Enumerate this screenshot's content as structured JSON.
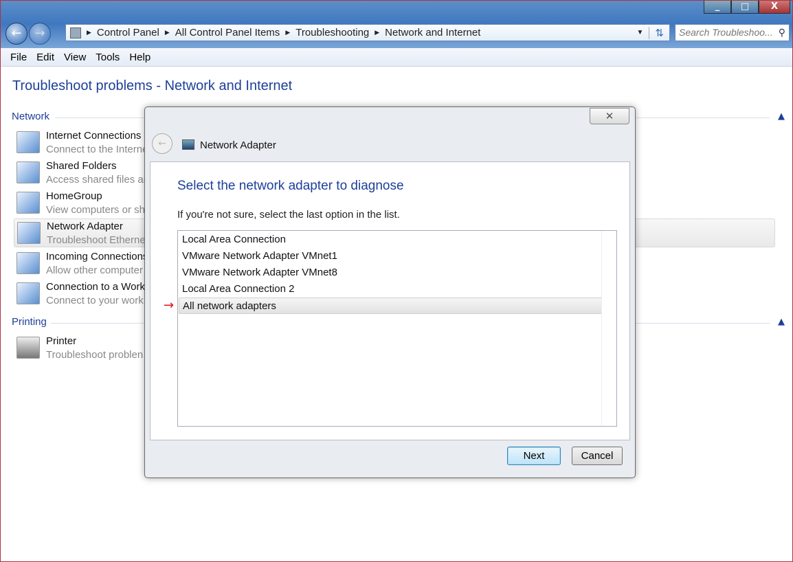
{
  "window": {
    "controls": [
      "_",
      "□",
      "X"
    ]
  },
  "breadcrumb": [
    "Control Panel",
    "All Control Panel Items",
    "Troubleshooting",
    "Network and Internet"
  ],
  "search": {
    "placeholder": "Search Troubleshoo..."
  },
  "menu": [
    "File",
    "Edit",
    "View",
    "Tools",
    "Help"
  ],
  "page_title": "Troubleshoot problems - Network and Internet",
  "groups": {
    "network": "Network",
    "printing": "Printing"
  },
  "items": [
    {
      "title": "Internet Connections",
      "desc": "Connect to the Interne"
    },
    {
      "title": "Shared Folders",
      "desc": "Access shared files an"
    },
    {
      "title": "HomeGroup",
      "desc": "View computers or sh"
    },
    {
      "title": "Network Adapter",
      "desc": "Troubleshoot Etherne"
    },
    {
      "title": "Incoming Connections",
      "desc": "Allow other computer"
    },
    {
      "title": "Connection to a Work",
      "desc": "Connect to your work"
    },
    {
      "title": "Printer",
      "desc": "Troubleshoot problen"
    }
  ],
  "dialog": {
    "close": "✕",
    "title": "Network Adapter",
    "heading": "Select the network adapter to diagnose",
    "hint": "If you're not sure, select the last option in the list.",
    "options": [
      "Local Area Connection",
      "VMware Network Adapter VMnet1",
      "VMware Network Adapter VMnet8",
      "Local Area Connection 2",
      "All network adapters"
    ],
    "selected_index": 4,
    "arrow": "→",
    "next": "Next",
    "cancel": "Cancel"
  }
}
